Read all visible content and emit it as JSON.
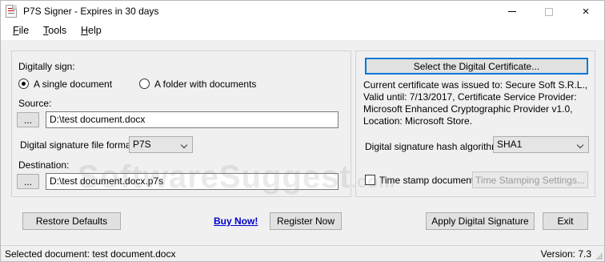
{
  "window": {
    "title": "P7S Signer - Expires in 30 days",
    "controls": {
      "minimize": "minimize-icon",
      "maximize": "maximize-icon",
      "close": "×"
    }
  },
  "menu": [
    "File",
    "Tools",
    "Help"
  ],
  "left_panel": {
    "digitally_sign_label": "Digitally sign:",
    "options": [
      {
        "label": "A single document",
        "selected": true
      },
      {
        "label": "A folder with  documents",
        "selected": false
      }
    ],
    "source_label": "Source:",
    "browse_label": "...",
    "source_value": "D:\\test document.docx",
    "format_label": "Digital signature file format:",
    "format_value": "P7S",
    "destination_label": "Destination:",
    "destination_value": "D:\\test document.docx.p7s"
  },
  "right_panel": {
    "select_cert_button": "Select the Digital Certificate...",
    "cert_info": "Current certificate was issued to: Secure Soft S.R.L., Valid until: 7/13/2017, Certificate Service Provider: Microsoft Enhanced Cryptographic Provider v1.0, Location: Microsoft Store.",
    "hash_label": "Digital signature hash algorithm:",
    "hash_value": "SHA1",
    "timestamp_label": "Time stamp document",
    "timestamp_checked": false,
    "timestamp_settings_button": "Time Stamping Settings..."
  },
  "buttons": {
    "restore_defaults": "Restore Defaults",
    "buy_now": "Buy Now!",
    "register_now": "Register Now",
    "apply_signature": "Apply Digital Signature",
    "exit": "Exit"
  },
  "watermark": {
    "main": "SoftwareSuggest",
    "suffix": ".com"
  },
  "status": {
    "selected_document": "Selected document: test document.docx",
    "version": "Version: 7.3"
  },
  "colors": {
    "link": "#0000cc",
    "focus": "#0078d7",
    "panel_bg": "#f0f0f0"
  }
}
